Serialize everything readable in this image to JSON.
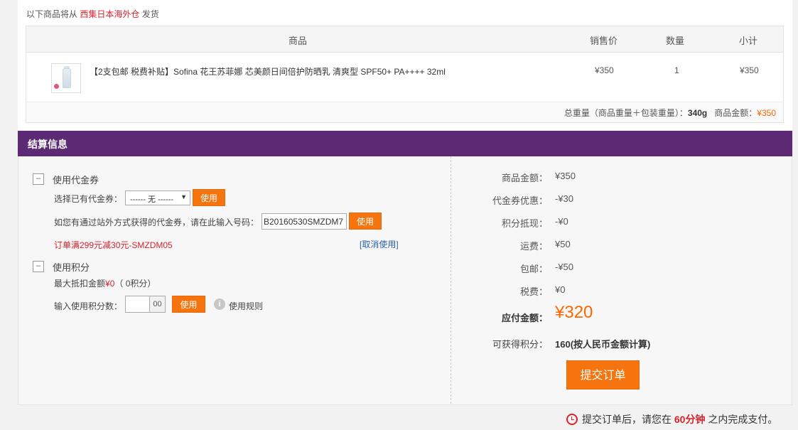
{
  "shipping": {
    "prefix": "以下商品将从",
    "warehouse": "西集日本海外仓",
    "suffix": "发货"
  },
  "goods_table": {
    "headers": {
      "name": "商品",
      "price": "销售价",
      "qty": "数量",
      "subtotal": "小计"
    },
    "items": [
      {
        "title": "【2支包邮 税费补贴】Sofina 花王苏菲娜 芯美颜日间倍护防晒乳 清爽型 SPF50+ PA++++ 32ml",
        "price": "¥350",
        "qty": "1",
        "subtotal": "¥350",
        "thumb_icon": "sunscreen-bottle-icon"
      }
    ],
    "footer": {
      "weight_label": "总重量（商品重量＋包装重量）：",
      "weight_value": "340g",
      "amount_label": "商品金额：",
      "amount_value": "¥350"
    }
  },
  "settle": {
    "title": "结算信息",
    "coupon": {
      "toggle": "–",
      "title": "使用代金券",
      "select_label": "选择已有代金券：",
      "select_value": "------ 无 ------",
      "use_label": "使用",
      "code_label": "如您有通过站外方式获得的代金券，请在此输入号码：",
      "code_value": "B20160530SMZDM7",
      "code_use_label": "使用",
      "applied_text": "订单满299元减30元-SMZDM05",
      "cancel_label": "[取消使用]"
    },
    "points": {
      "toggle": "–",
      "title": "使用积分",
      "max_label": "最大抵扣金额",
      "max_value": "¥0",
      "max_points": "（ 0积分）",
      "input_label": "输入使用积分数：",
      "input_suffix": "00",
      "use_label": "使用",
      "rule_icon": "i",
      "rule_label": "使用规则"
    },
    "summary": [
      {
        "key": "商品金额：",
        "value": "¥350"
      },
      {
        "key": "代金券优惠：",
        "value": "-¥30"
      },
      {
        "key": "积分抵现：",
        "value": "-¥0"
      },
      {
        "key": "运费：",
        "value": "¥50"
      },
      {
        "key": "包邮：",
        "value": "-¥50"
      },
      {
        "key": "税费：",
        "value": "¥0"
      }
    ],
    "total": {
      "key": "应付金额：",
      "value": "¥320"
    },
    "earn_points": {
      "key": "可获得积分：",
      "value": "160(按人民币金额计算)"
    },
    "submit_label": "提交订单"
  },
  "countdown": {
    "prefix": "提交订单后，请您在",
    "minutes": "60分钟",
    "suffix": "之内完成支付。"
  },
  "colors": {
    "accent_orange": "#f5740e",
    "header_purple": "#5c2a74",
    "price_orange": "#ff6600",
    "alert_red": "#d9222a"
  }
}
